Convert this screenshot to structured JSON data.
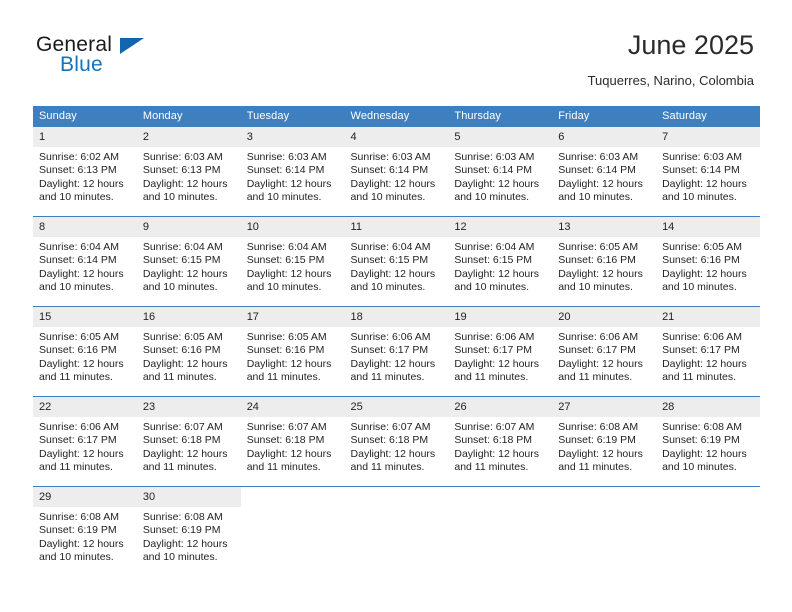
{
  "brand": {
    "name_part1": "General",
    "name_part2": "Blue",
    "flag_icon": "triangle-flag-icon",
    "accent_color": "#1266ad"
  },
  "header": {
    "title": "June 2025",
    "subtitle": "Tuquerres, Narino, Colombia"
  },
  "theme": {
    "header_blue": "#3d7fbf",
    "daynum_gray": "#ededed",
    "text": "#231f20"
  },
  "weekdays": [
    "Sunday",
    "Monday",
    "Tuesday",
    "Wednesday",
    "Thursday",
    "Friday",
    "Saturday"
  ],
  "weeks": [
    [
      {
        "day": "1",
        "sunrise": "Sunrise: 6:02 AM",
        "sunset": "Sunset: 6:13 PM",
        "daylight": "Daylight: 12 hours and 10 minutes."
      },
      {
        "day": "2",
        "sunrise": "Sunrise: 6:03 AM",
        "sunset": "Sunset: 6:13 PM",
        "daylight": "Daylight: 12 hours and 10 minutes."
      },
      {
        "day": "3",
        "sunrise": "Sunrise: 6:03 AM",
        "sunset": "Sunset: 6:14 PM",
        "daylight": "Daylight: 12 hours and 10 minutes."
      },
      {
        "day": "4",
        "sunrise": "Sunrise: 6:03 AM",
        "sunset": "Sunset: 6:14 PM",
        "daylight": "Daylight: 12 hours and 10 minutes."
      },
      {
        "day": "5",
        "sunrise": "Sunrise: 6:03 AM",
        "sunset": "Sunset: 6:14 PM",
        "daylight": "Daylight: 12 hours and 10 minutes."
      },
      {
        "day": "6",
        "sunrise": "Sunrise: 6:03 AM",
        "sunset": "Sunset: 6:14 PM",
        "daylight": "Daylight: 12 hours and 10 minutes."
      },
      {
        "day": "7",
        "sunrise": "Sunrise: 6:03 AM",
        "sunset": "Sunset: 6:14 PM",
        "daylight": "Daylight: 12 hours and 10 minutes."
      }
    ],
    [
      {
        "day": "8",
        "sunrise": "Sunrise: 6:04 AM",
        "sunset": "Sunset: 6:14 PM",
        "daylight": "Daylight: 12 hours and 10 minutes."
      },
      {
        "day": "9",
        "sunrise": "Sunrise: 6:04 AM",
        "sunset": "Sunset: 6:15 PM",
        "daylight": "Daylight: 12 hours and 10 minutes."
      },
      {
        "day": "10",
        "sunrise": "Sunrise: 6:04 AM",
        "sunset": "Sunset: 6:15 PM",
        "daylight": "Daylight: 12 hours and 10 minutes."
      },
      {
        "day": "11",
        "sunrise": "Sunrise: 6:04 AM",
        "sunset": "Sunset: 6:15 PM",
        "daylight": "Daylight: 12 hours and 10 minutes."
      },
      {
        "day": "12",
        "sunrise": "Sunrise: 6:04 AM",
        "sunset": "Sunset: 6:15 PM",
        "daylight": "Daylight: 12 hours and 10 minutes."
      },
      {
        "day": "13",
        "sunrise": "Sunrise: 6:05 AM",
        "sunset": "Sunset: 6:16 PM",
        "daylight": "Daylight: 12 hours and 10 minutes."
      },
      {
        "day": "14",
        "sunrise": "Sunrise: 6:05 AM",
        "sunset": "Sunset: 6:16 PM",
        "daylight": "Daylight: 12 hours and 10 minutes."
      }
    ],
    [
      {
        "day": "15",
        "sunrise": "Sunrise: 6:05 AM",
        "sunset": "Sunset: 6:16 PM",
        "daylight": "Daylight: 12 hours and 11 minutes."
      },
      {
        "day": "16",
        "sunrise": "Sunrise: 6:05 AM",
        "sunset": "Sunset: 6:16 PM",
        "daylight": "Daylight: 12 hours and 11 minutes."
      },
      {
        "day": "17",
        "sunrise": "Sunrise: 6:05 AM",
        "sunset": "Sunset: 6:16 PM",
        "daylight": "Daylight: 12 hours and 11 minutes."
      },
      {
        "day": "18",
        "sunrise": "Sunrise: 6:06 AM",
        "sunset": "Sunset: 6:17 PM",
        "daylight": "Daylight: 12 hours and 11 minutes."
      },
      {
        "day": "19",
        "sunrise": "Sunrise: 6:06 AM",
        "sunset": "Sunset: 6:17 PM",
        "daylight": "Daylight: 12 hours and 11 minutes."
      },
      {
        "day": "20",
        "sunrise": "Sunrise: 6:06 AM",
        "sunset": "Sunset: 6:17 PM",
        "daylight": "Daylight: 12 hours and 11 minutes."
      },
      {
        "day": "21",
        "sunrise": "Sunrise: 6:06 AM",
        "sunset": "Sunset: 6:17 PM",
        "daylight": "Daylight: 12 hours and 11 minutes."
      }
    ],
    [
      {
        "day": "22",
        "sunrise": "Sunrise: 6:06 AM",
        "sunset": "Sunset: 6:17 PM",
        "daylight": "Daylight: 12 hours and 11 minutes."
      },
      {
        "day": "23",
        "sunrise": "Sunrise: 6:07 AM",
        "sunset": "Sunset: 6:18 PM",
        "daylight": "Daylight: 12 hours and 11 minutes."
      },
      {
        "day": "24",
        "sunrise": "Sunrise: 6:07 AM",
        "sunset": "Sunset: 6:18 PM",
        "daylight": "Daylight: 12 hours and 11 minutes."
      },
      {
        "day": "25",
        "sunrise": "Sunrise: 6:07 AM",
        "sunset": "Sunset: 6:18 PM",
        "daylight": "Daylight: 12 hours and 11 minutes."
      },
      {
        "day": "26",
        "sunrise": "Sunrise: 6:07 AM",
        "sunset": "Sunset: 6:18 PM",
        "daylight": "Daylight: 12 hours and 11 minutes."
      },
      {
        "day": "27",
        "sunrise": "Sunrise: 6:08 AM",
        "sunset": "Sunset: 6:19 PM",
        "daylight": "Daylight: 12 hours and 11 minutes."
      },
      {
        "day": "28",
        "sunrise": "Sunrise: 6:08 AM",
        "sunset": "Sunset: 6:19 PM",
        "daylight": "Daylight: 12 hours and 10 minutes."
      }
    ],
    [
      {
        "day": "29",
        "sunrise": "Sunrise: 6:08 AM",
        "sunset": "Sunset: 6:19 PM",
        "daylight": "Daylight: 12 hours and 10 minutes."
      },
      {
        "day": "30",
        "sunrise": "Sunrise: 6:08 AM",
        "sunset": "Sunset: 6:19 PM",
        "daylight": "Daylight: 12 hours and 10 minutes."
      },
      null,
      null,
      null,
      null,
      null
    ]
  ]
}
